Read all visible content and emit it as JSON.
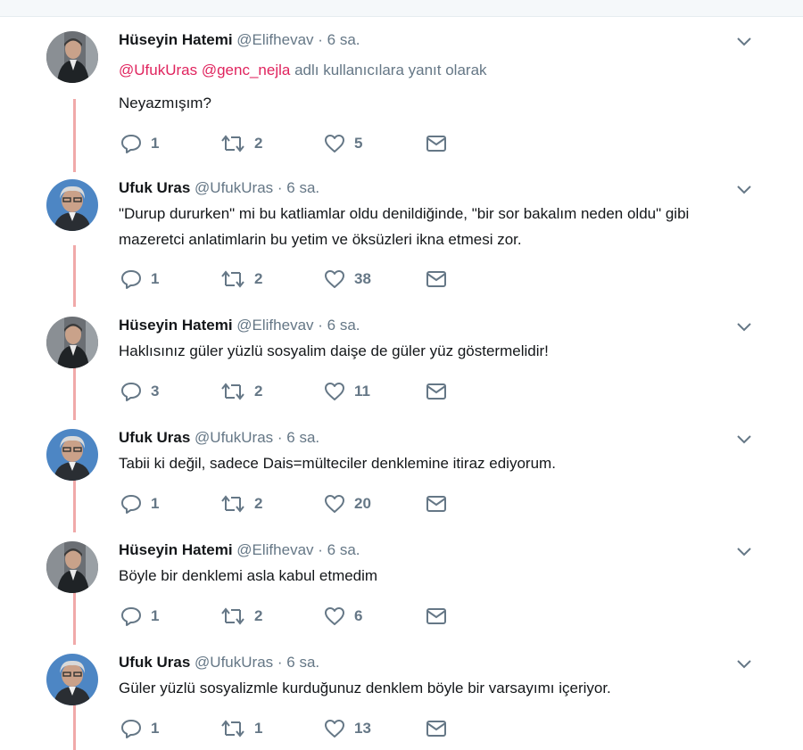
{
  "tweets": [
    {
      "name": "Hüseyin Hatemi",
      "handle": "@Elifhevav",
      "time": "· 6 sa.",
      "replying": {
        "mention1": "@UfukUras",
        "mention2": "@genc_nejla",
        "suffix": "adlı kullanıcılara yanıt olarak"
      },
      "text": "Neyazmışım?",
      "replies": "1",
      "retweets": "2",
      "likes": "5",
      "avatar": "avatar-hatemi"
    },
    {
      "name": "Ufuk Uras",
      "handle": "@UfukUras",
      "time": "· 6 sa.",
      "text": "\"Durup dururken\" mi bu katliamlar oldu  denildiğinde, \"bir sor bakalım neden oldu\" gibi mazeretci anlatimlarin bu yetim ve öksüzleri ikna etmesi zor.",
      "replies": "1",
      "retweets": "2",
      "likes": "38",
      "avatar": "avatar-uras"
    },
    {
      "name": "Hüseyin Hatemi",
      "handle": "@Elifhevav",
      "time": "· 6 sa.",
      "text": "Haklısınız güler yüzlü sosyalim daişe de güler yüz göstermelidir!",
      "replies": "3",
      "retweets": "2",
      "likes": "11",
      "avatar": "avatar-hatemi"
    },
    {
      "name": "Ufuk Uras",
      "handle": "@UfukUras",
      "time": "· 6 sa.",
      "text": "Tabii ki değil, sadece Dais=mülteciler denklemine itiraz ediyorum.",
      "replies": "1",
      "retweets": "2",
      "likes": "20",
      "avatar": "avatar-uras"
    },
    {
      "name": "Hüseyin Hatemi",
      "handle": "@Elifhevav",
      "time": "· 6 sa.",
      "text": "Böyle bir denklemi asla kabul etmedim",
      "replies": "1",
      "retweets": "2",
      "likes": "6",
      "avatar": "avatar-hatemi"
    },
    {
      "name": "Ufuk Uras",
      "handle": "@UfukUras",
      "time": "· 6 sa.",
      "text": "Güler yüzlü sosyalizmle kurduğunuz denklem böyle bir varsayımı içeriyor.",
      "replies": "1",
      "retweets": "1",
      "likes": "13",
      "avatar": "avatar-uras"
    }
  ],
  "colors": {
    "thread": "#f0a9a9",
    "mention": "#e0245e",
    "meta": "#657786",
    "text": "#14171a"
  },
  "icons": {
    "reply": "reply-icon",
    "retweet": "retweet-icon",
    "like": "heart-icon",
    "dm": "envelope-icon",
    "menu": "chevron-down-icon"
  }
}
